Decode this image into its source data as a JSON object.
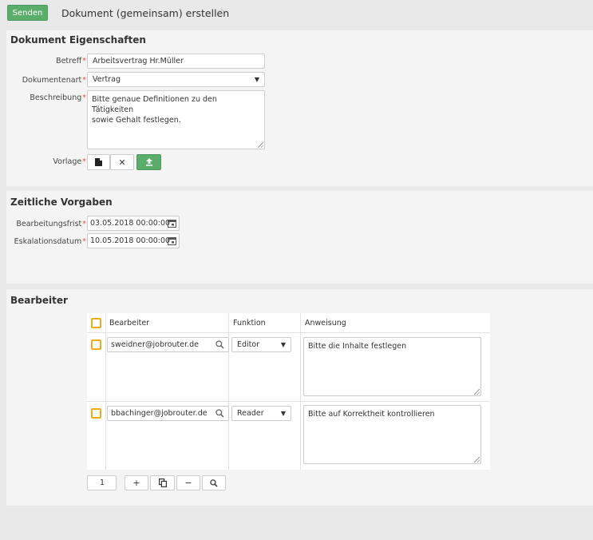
{
  "toolbar": {
    "send_label": "Senden",
    "title": "Dokument (gemeinsam) erstellen"
  },
  "props": {
    "title": "Dokument Eigenschaften",
    "betreff_label": "Betreff",
    "betreff_value": "Arbeitsvertrag Hr.Müller",
    "art_label": "Dokumentenart",
    "art_value": "Vertrag",
    "beschreibung_label": "Beschreibung",
    "beschreibung_line1": "Bitte genaue Definitionen zu den Tätigkeiten",
    "beschreibung_line2": "sowie Gehalt festlegen.",
    "vorlage_label": "Vorlage"
  },
  "time": {
    "title": "Zeitliche Vorgaben",
    "frist_label": "Bearbeitungsfrist",
    "frist_value": "03.05.2018 00:00:00",
    "eskalation_label": "Eskalationsdatum",
    "eskalation_value": "10.05.2018 00:00:00"
  },
  "workers": {
    "title": "Bearbeiter",
    "columns": [
      "Bearbeiter",
      "Funktion",
      "Anweisung"
    ],
    "rows": [
      {
        "user": "sweidner@jobrouter.de",
        "function": "Editor",
        "instruction": "Bitte die Inhalte festlegen"
      },
      {
        "user": "bbachinger@jobrouter.de",
        "function": "Reader",
        "instruction": "Bitte auf Korrektheit kontrollieren"
      }
    ],
    "page": "1"
  },
  "required_marker": "*"
}
